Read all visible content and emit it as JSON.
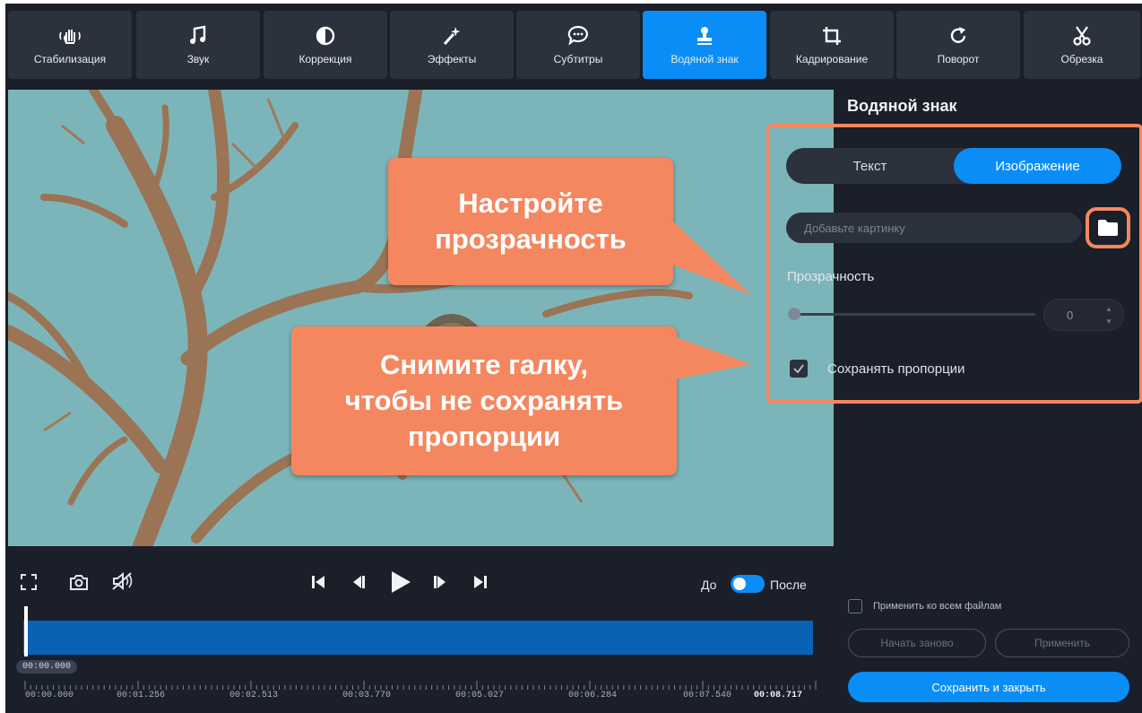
{
  "toolbar": {
    "items": [
      {
        "label": "Стабилизация",
        "icon": "hand-stabilization-icon"
      },
      {
        "label": "Звук",
        "icon": "music-note-icon"
      },
      {
        "label": "Коррекция",
        "icon": "contrast-icon"
      },
      {
        "label": "Эффекты",
        "icon": "magic-wand-icon"
      },
      {
        "label": "Субтитры",
        "icon": "speech-bubble-icon"
      },
      {
        "label": "Водяной знак",
        "icon": "stamp-icon",
        "active": true
      },
      {
        "label": "Кадрирование",
        "icon": "crop-icon"
      },
      {
        "label": "Поворот",
        "icon": "rotate-icon"
      },
      {
        "label": "Обрезка",
        "icon": "scissors-icon"
      }
    ]
  },
  "callouts": {
    "opacity_line1": "Настройте",
    "opacity_line2": "прозрачность",
    "proportions_line1": "Снимите галку,",
    "proportions_line2": "чтобы не сохранять",
    "proportions_line3": "пропорции"
  },
  "panel": {
    "title": "Водяной знак",
    "tab_text": "Текст",
    "tab_image": "Изображение",
    "image_placeholder": "Добавьте картинку",
    "opacity_label": "Прозрачность",
    "opacity_value": "0",
    "keep_proportions_label": "Сохранять пропорции",
    "keep_proportions_checked": true
  },
  "actions": {
    "apply_all_label": "Применить ко всем файлам",
    "reset_label": "Начать заново",
    "apply_label": "Применить",
    "save_close_label": "Сохранить и закрыть"
  },
  "player": {
    "before_label": "До",
    "after_label": "После"
  },
  "timeline": {
    "current_time": "00:00.000",
    "labels": [
      "00:00.000",
      "00:01.256",
      "00:02.513",
      "00:03.770",
      "00:05.027",
      "00:06.284",
      "00:07.540",
      "00:08.717"
    ]
  },
  "colors": {
    "accent": "#0b8df7",
    "callout": "#f4875f",
    "background": "#1a1f2a"
  }
}
